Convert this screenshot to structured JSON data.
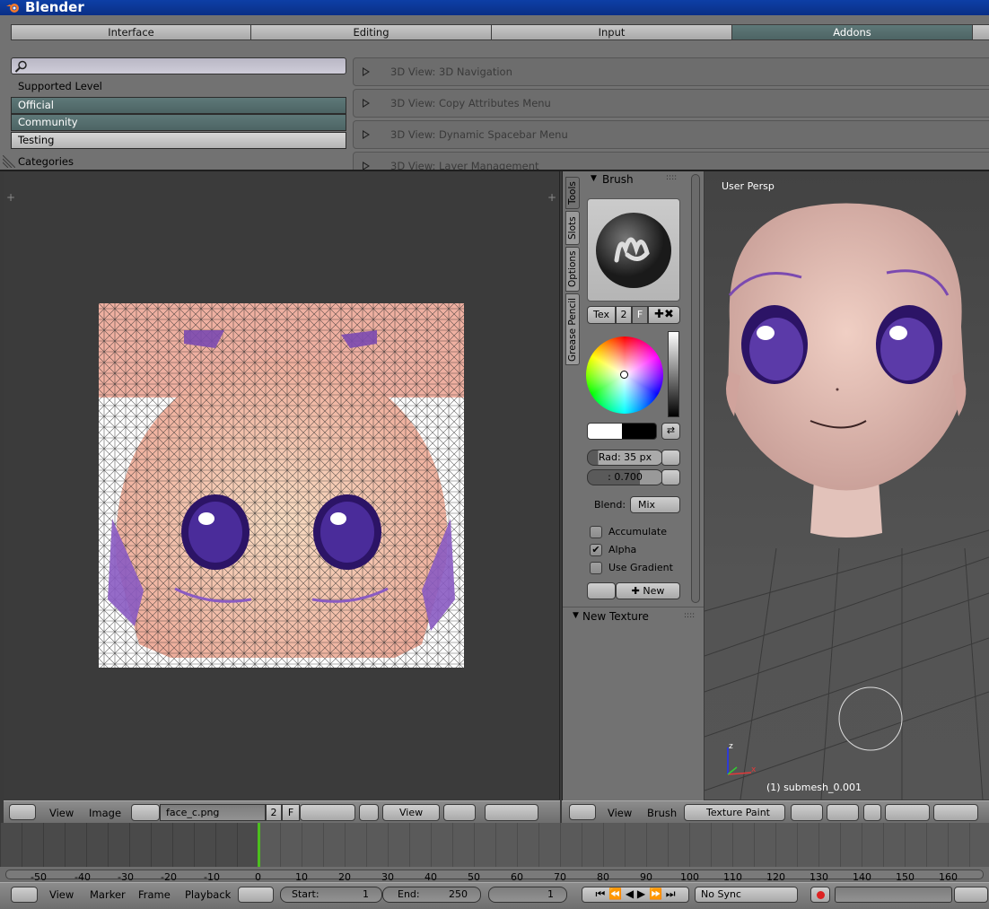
{
  "app": {
    "title": "Blender"
  },
  "prefs": {
    "tabs": [
      "Interface",
      "Editing",
      "Input",
      "Addons"
    ],
    "active_tab": "Addons",
    "supported_level_label": "Supported Level",
    "levels": [
      "Official",
      "Community",
      "Testing"
    ],
    "categories_label": "Categories",
    "addons": [
      "3D View: 3D Navigation",
      "3D View: Copy Attributes Menu",
      "3D View: Dynamic Spacebar Menu",
      "3D View: Layer Management"
    ]
  },
  "image_editor": {
    "menus": [
      "View",
      "Image"
    ],
    "image_name": "face_c.png",
    "users": "2",
    "fake": "F",
    "view_label": "View"
  },
  "tool_panel": {
    "vtabs": [
      "Tools",
      "Slots",
      "Options",
      "Grease Pencil"
    ],
    "brush_title": "Brush",
    "tex_label": "Tex",
    "tex_users": "2",
    "tex_fake": "F",
    "radius": "Rad: 35 px",
    "strength": ": 0.700",
    "blend_label": "Blend:",
    "blend_value": "Mix",
    "accumulate": "Accumulate",
    "alpha": "Alpha",
    "use_gradient": "Use Gradient",
    "new_label": "New",
    "new_texture": "New Texture",
    "alpha_checked": true
  },
  "viewport": {
    "persp": "User Persp",
    "object": "(1) submesh_0.001",
    "menus": [
      "View",
      "Brush"
    ],
    "mode": "Texture Paint",
    "axis_z": "z",
    "axis_x": "x"
  },
  "timeline": {
    "ticks": [
      "-50",
      "-40",
      "-30",
      "-20",
      "-10",
      "0",
      "10",
      "20",
      "30",
      "40",
      "50",
      "60",
      "70",
      "80",
      "90",
      "100",
      "110",
      "120",
      "130",
      "140",
      "150",
      "160"
    ],
    "menus": [
      "View",
      "Marker",
      "Frame",
      "Playback"
    ],
    "start": "Start:",
    "start_val": "1",
    "end": "End:",
    "end_val": "250",
    "current": "1",
    "sync": "No Sync"
  },
  "colors": {
    "accent": "#4d6464",
    "title_bar": "#0d3fa6",
    "frame_marker": "#4cbf1e"
  }
}
